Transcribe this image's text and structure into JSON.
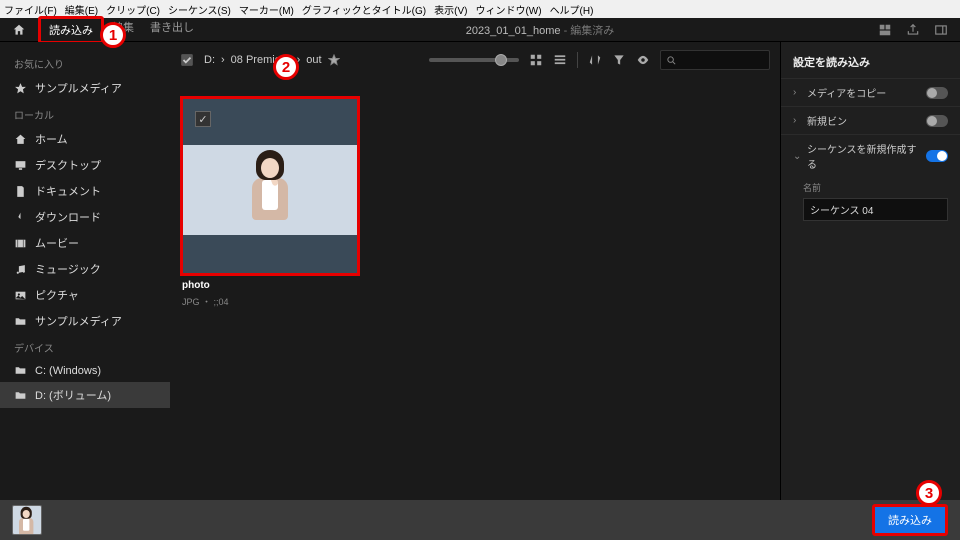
{
  "menubar": [
    "ファイル(F)",
    "編集(E)",
    "クリップ(C)",
    "シーケンス(S)",
    "マーカー(M)",
    "グラフィックとタイトル(G)",
    "表示(V)",
    "ウィンドウ(W)",
    "ヘルプ(H)"
  ],
  "topbar": {
    "tab_import": "読み込み",
    "tab_edit": "編集",
    "tab_export": "書き出し",
    "title": "2023_01_01_home",
    "title_suffix": " - 編集済み"
  },
  "sidebar": {
    "favorites_head": "お気に入り",
    "favorites": [
      {
        "icon": "star",
        "label": "サンプルメディア"
      }
    ],
    "local_head": "ローカル",
    "local": [
      {
        "icon": "home",
        "label": "ホーム"
      },
      {
        "icon": "desktop",
        "label": "デスクトップ"
      },
      {
        "icon": "doc",
        "label": "ドキュメント"
      },
      {
        "icon": "download",
        "label": "ダウンロード"
      },
      {
        "icon": "movie",
        "label": "ムービー"
      },
      {
        "icon": "music",
        "label": "ミュージック"
      },
      {
        "icon": "picture",
        "label": "ピクチャ"
      },
      {
        "icon": "folder",
        "label": "サンプルメディア"
      }
    ],
    "devices_head": "デバイス",
    "devices": [
      {
        "icon": "folder",
        "label": "C: (Windows)"
      },
      {
        "icon": "folder",
        "label": "D: (ボリューム)",
        "active": true
      }
    ]
  },
  "breadcrumb": {
    "drive": "D:",
    "path1": "08 Premiere",
    "path2": "out"
  },
  "thumb": {
    "label": "photo",
    "meta": "JPG ・ ;;04"
  },
  "rightpanel": {
    "title": "設定を読み込み",
    "copy_media": "メディアをコピー",
    "new_bin": "新規ビン",
    "create_seq": "シーケンスを新規作成する",
    "name_label": "名前",
    "name_value": "シーケンス 04"
  },
  "footer": {
    "import_btn": "読み込み"
  },
  "badges": {
    "b1": "1",
    "b2": "2",
    "b3": "3"
  }
}
